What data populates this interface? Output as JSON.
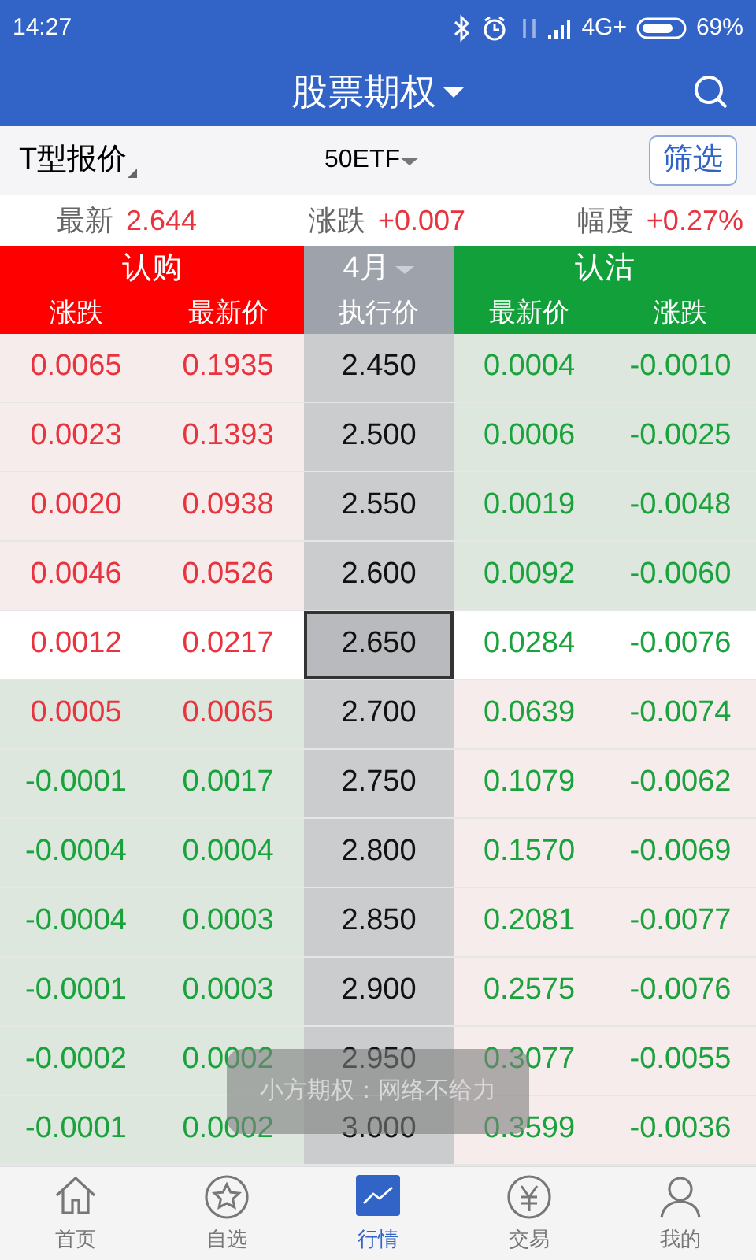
{
  "status_bar": {
    "time": "14:27",
    "network": "4G+",
    "battery": "69%"
  },
  "header": {
    "title": "股票期权"
  },
  "toolbar": {
    "view": "T型报价",
    "underlying": "50ETF",
    "filter_button": "筛选"
  },
  "quote": [
    {
      "label": "最新",
      "value": "2.644"
    },
    {
      "label": "涨跌",
      "value": "+0.007"
    },
    {
      "label": "幅度",
      "value": "+0.27%"
    }
  ],
  "table": {
    "call_title": "认购",
    "month": "4月",
    "put_title": "认沽",
    "columns": [
      "涨跌",
      "最新价",
      "执行价",
      "最新价",
      "涨跌"
    ],
    "rows": [
      {
        "call_change": "0.0065",
        "call_last": "0.1935",
        "strike": "2.450",
        "put_last": "0.0004",
        "put_change": "-0.0010",
        "call_up": true,
        "put_up": false,
        "call_in_money": true,
        "selected": false
      },
      {
        "call_change": "0.0023",
        "call_last": "0.1393",
        "strike": "2.500",
        "put_last": "0.0006",
        "put_change": "-0.0025",
        "call_up": true,
        "put_up": false,
        "call_in_money": true,
        "selected": false
      },
      {
        "call_change": "0.0020",
        "call_last": "0.0938",
        "strike": "2.550",
        "put_last": "0.0019",
        "put_change": "-0.0048",
        "call_up": true,
        "put_up": false,
        "call_in_money": true,
        "selected": false
      },
      {
        "call_change": "0.0046",
        "call_last": "0.0526",
        "strike": "2.600",
        "put_last": "0.0092",
        "put_change": "-0.0060",
        "call_up": true,
        "put_up": false,
        "call_in_money": true,
        "selected": false
      },
      {
        "call_change": "0.0012",
        "call_last": "0.0217",
        "strike": "2.650",
        "put_last": "0.0284",
        "put_change": "-0.0076",
        "call_up": true,
        "put_up": false,
        "selected": true
      },
      {
        "call_change": "0.0005",
        "call_last": "0.0065",
        "strike": "2.700",
        "put_last": "0.0639",
        "put_change": "-0.0074",
        "call_up": true,
        "put_up": false,
        "call_in_money": false,
        "selected": false
      },
      {
        "call_change": "-0.0001",
        "call_last": "0.0017",
        "strike": "2.750",
        "put_last": "0.1079",
        "put_change": "-0.0062",
        "call_up": false,
        "put_up": false,
        "call_in_money": false,
        "selected": false
      },
      {
        "call_change": "-0.0004",
        "call_last": "0.0004",
        "strike": "2.800",
        "put_last": "0.1570",
        "put_change": "-0.0069",
        "call_up": false,
        "put_up": false,
        "call_in_money": false,
        "selected": false
      },
      {
        "call_change": "-0.0004",
        "call_last": "0.0003",
        "strike": "2.850",
        "put_last": "0.2081",
        "put_change": "-0.0077",
        "call_up": false,
        "put_up": false,
        "call_in_money": false,
        "selected": false
      },
      {
        "call_change": "-0.0001",
        "call_last": "0.0003",
        "strike": "2.900",
        "put_last": "0.2575",
        "put_change": "-0.0076",
        "call_up": false,
        "put_up": false,
        "call_in_money": false,
        "selected": false
      },
      {
        "call_change": "-0.0002",
        "call_last": "0.0002",
        "strike": "2.950",
        "put_last": "0.3077",
        "put_change": "-0.0055",
        "call_up": false,
        "put_up": false,
        "call_in_money": false,
        "selected": false
      },
      {
        "call_change": "-0.0001",
        "call_last": "0.0002",
        "strike": "3.000",
        "put_last": "0.3599",
        "put_change": "-0.0036",
        "call_up": false,
        "put_up": false,
        "call_in_money": false,
        "selected": false
      }
    ]
  },
  "toast": "小方期权：网络不给力",
  "nav": [
    {
      "label": "首页",
      "kind": "home",
      "selected": false
    },
    {
      "label": "自选",
      "kind": "star",
      "selected": false
    },
    {
      "label": "行情",
      "kind": "chart",
      "selected": true
    },
    {
      "label": "交易",
      "kind": "yen",
      "selected": false
    },
    {
      "label": "我的",
      "kind": "user",
      "selected": false
    }
  ]
}
